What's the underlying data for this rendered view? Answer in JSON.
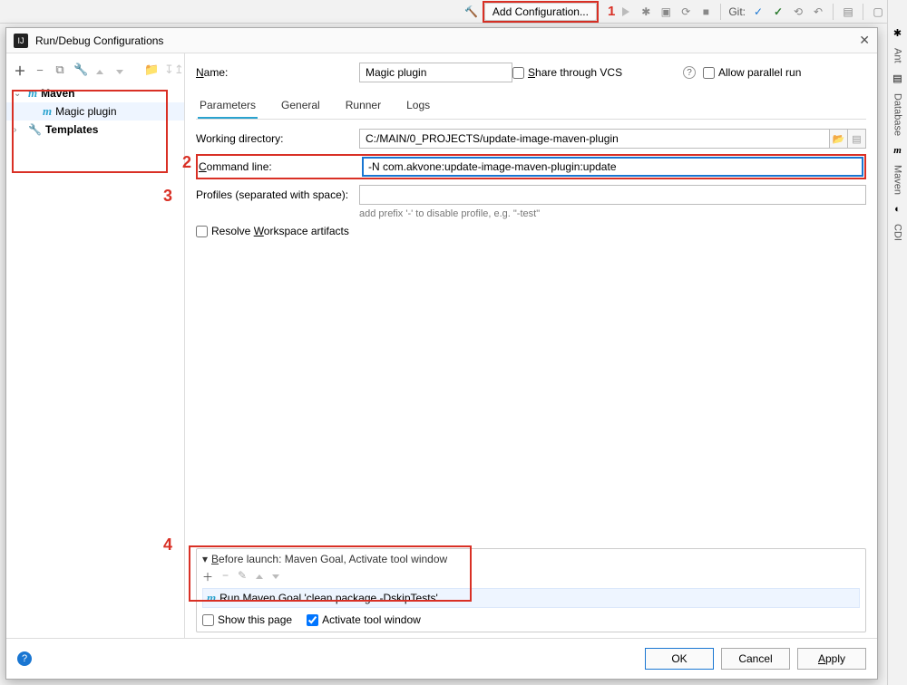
{
  "toolbar": {
    "add_configuration": "Add Configuration...",
    "callout1": "1",
    "git_label": "Git:"
  },
  "right_strip": {
    "ant": "Ant",
    "database": "Database",
    "maven": "Maven",
    "cdi": "CDI"
  },
  "dialog": {
    "title": "Run/Debug Configurations"
  },
  "sidebar": {
    "callout2": "2",
    "nodes": {
      "maven": "Maven",
      "magic_plugin": "Magic plugin",
      "templates": "Templates"
    }
  },
  "main": {
    "name_label": "Name:",
    "name_value": "Magic plugin",
    "share_label": "Share through VCS",
    "allow_parallel": "Allow parallel run",
    "callout3": "3",
    "tabs": {
      "parameters": "Parameters",
      "general": "General",
      "runner": "Runner",
      "logs": "Logs"
    },
    "labels": {
      "working_dir": "Working directory:",
      "command_line": "Command line:",
      "profiles": "Profiles (separated with space):",
      "hint": "add prefix '-' to disable profile, e.g. \"-test\"",
      "resolve": "Resolve Workspace artifacts"
    },
    "values": {
      "working_dir": "C:/MAIN/0_PROJECTS/update-image-maven-plugin",
      "command_line": "-N com.akvone:update-image-maven-plugin:update",
      "profiles": ""
    }
  },
  "before_launch": {
    "callout4": "4",
    "header": "Before launch: Maven Goal, Activate tool window",
    "item": "Run Maven Goal 'clean package -DskipTests'",
    "show_this_page": "Show this page",
    "activate_tool_window": "Activate tool window"
  },
  "buttons": {
    "ok": "OK",
    "cancel": "Cancel",
    "apply": "Apply"
  }
}
